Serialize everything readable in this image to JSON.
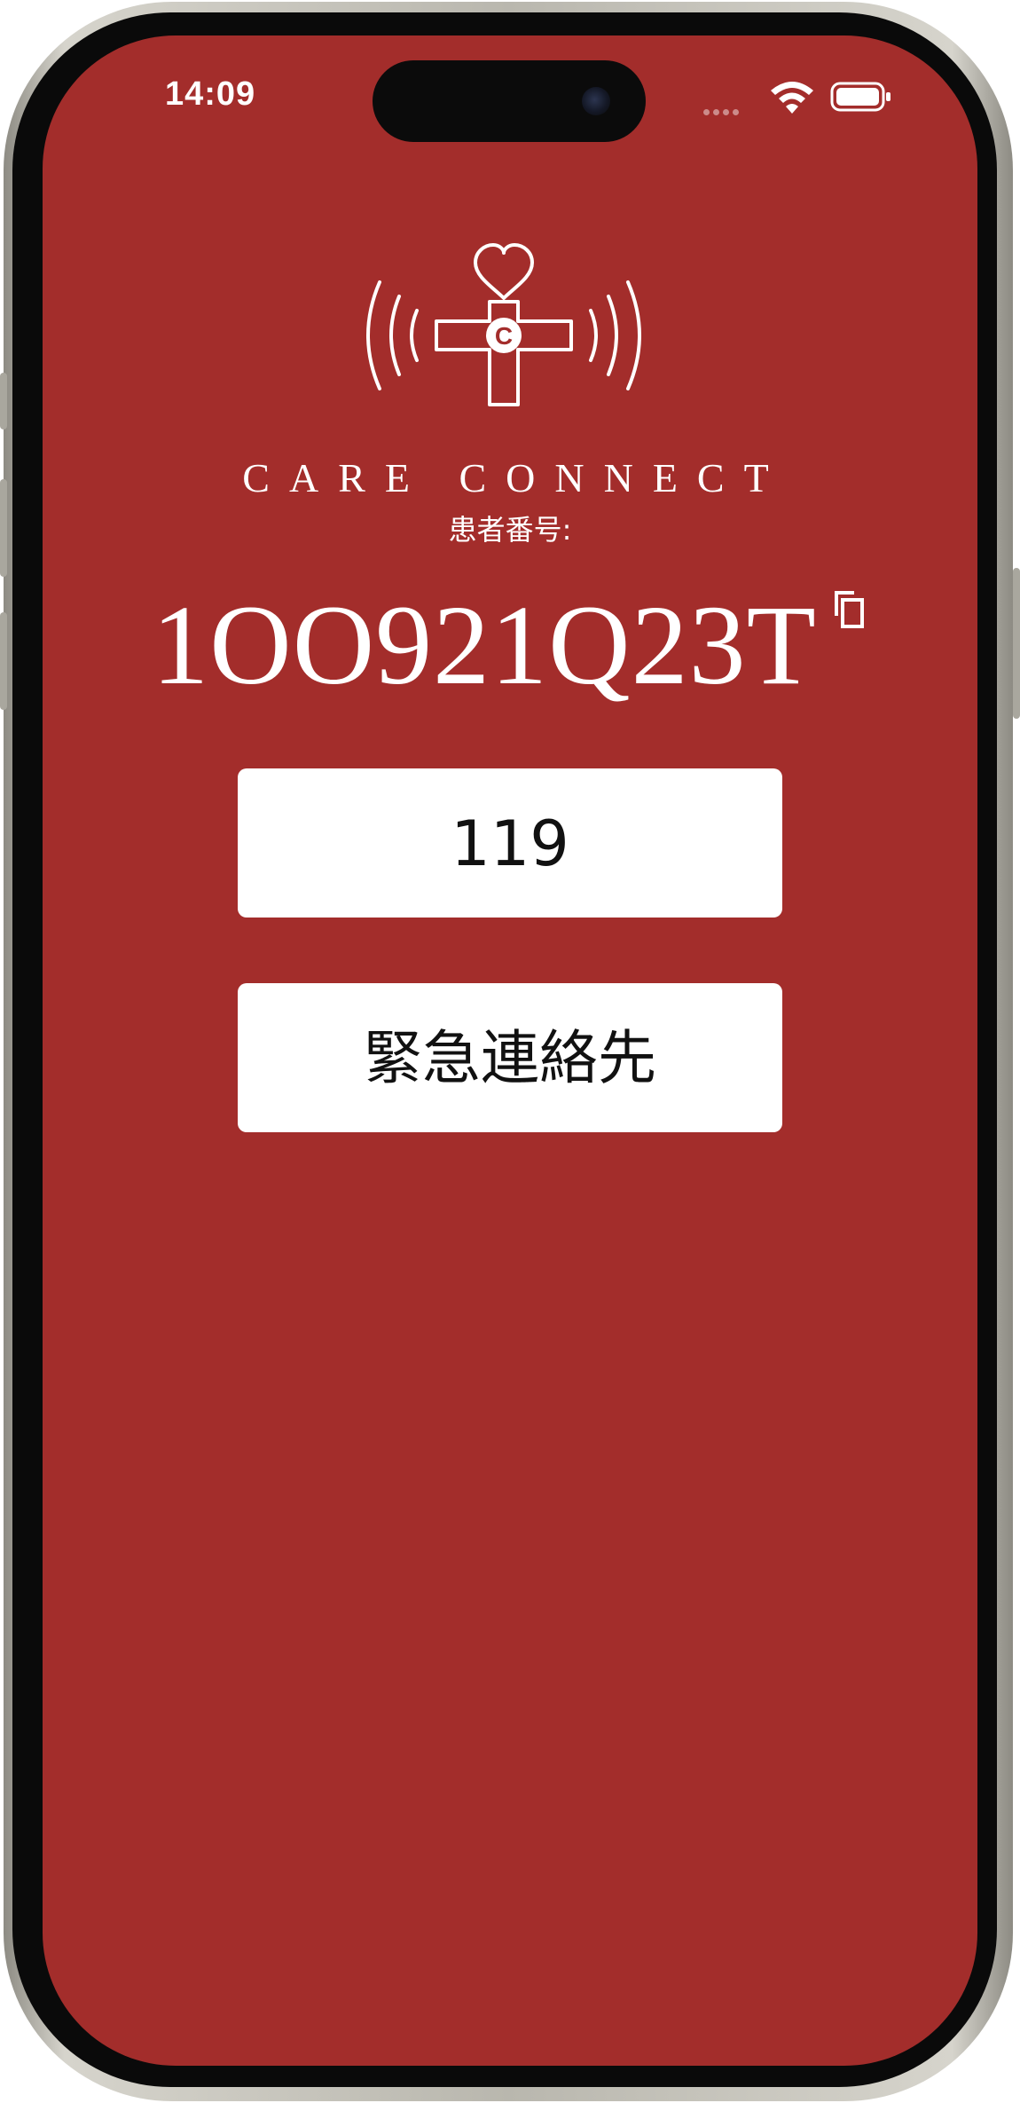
{
  "status_bar": {
    "time": "14:09",
    "icons": [
      "cellular-dots-icon",
      "wifi-icon",
      "battery-icon"
    ]
  },
  "app": {
    "brand_name": "CARE CONNECT",
    "logo_icon": "care-connect-logo-icon"
  },
  "patient": {
    "label": "患者番号:",
    "number": "1OO921Q23T",
    "copy_icon": "copy-icon"
  },
  "buttons": {
    "emergency_call_label": "119",
    "emergency_contact_label": "緊急連絡先"
  },
  "colors": {
    "screen_background": "#a32d2b",
    "button_background": "#ffffff",
    "text_on_background": "#ffffff",
    "button_text": "#111111"
  }
}
